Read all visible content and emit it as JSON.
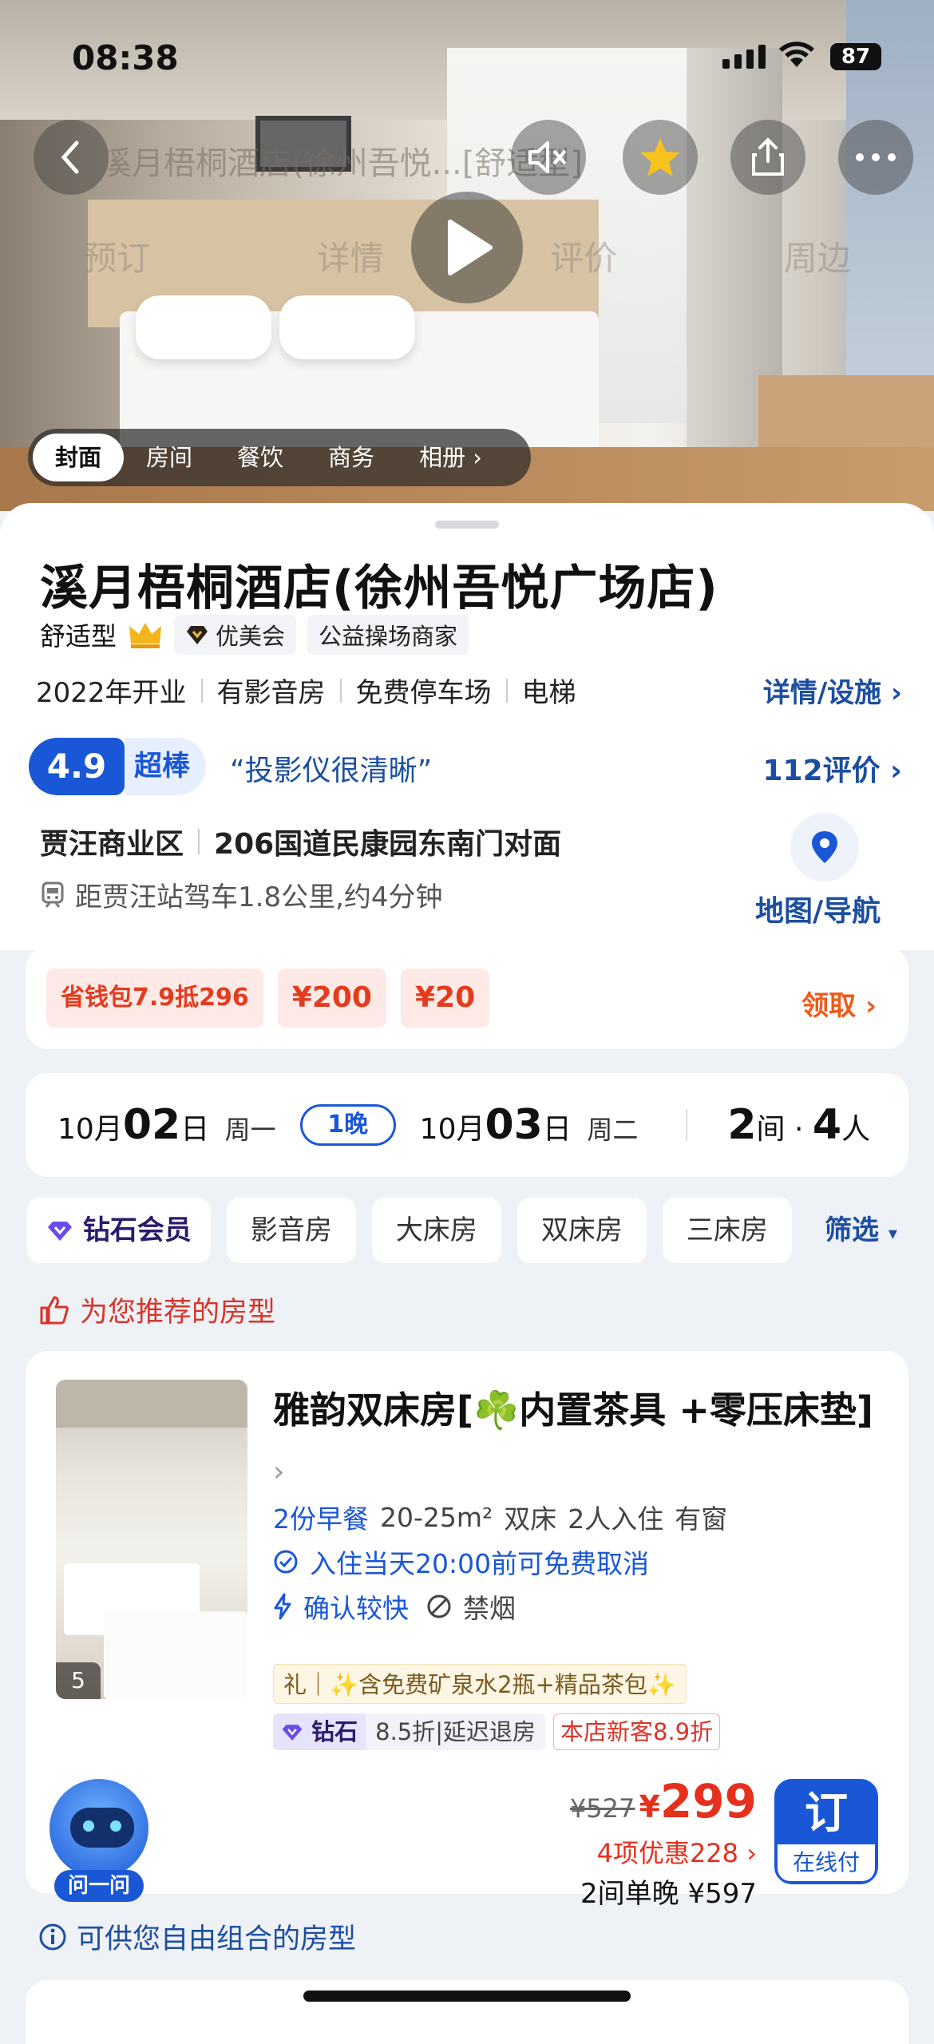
{
  "status_bar": {
    "time": "08:38",
    "battery": "87"
  },
  "nav": {
    "title": "溪月梧桐酒店(徐州吾悦...[舒适型]",
    "tabs": [
      "预订",
      "详情",
      "评价",
      "周边"
    ],
    "collect_label": "收藏",
    "more_label": "更多"
  },
  "media_tabs": [
    "封面",
    "房间",
    "餐饮",
    "商务",
    "相册"
  ],
  "hotel": {
    "name": "溪月梧桐酒店(徐州吾悦广场店)",
    "type": "舒适型",
    "member": "优美会",
    "merchant": "公益操场商家",
    "facilities": [
      "2022年开业",
      "有影音房",
      "免费停车场",
      "电梯"
    ],
    "details_link": "详情/设施",
    "score": "4.9",
    "score_word": "超棒",
    "quote": "“投影仪很清晰”",
    "reviews": "112评价",
    "district": "贾汪商业区",
    "address": "206国道民康园东南门对面",
    "distance": "距贾汪站驾车1.8公里,约4分钟",
    "map_label": "地图/导航"
  },
  "coupons": {
    "items": [
      "省钱包7.9抵296",
      "¥200",
      "¥20"
    ],
    "claim": "领取"
  },
  "dates": {
    "checkin_month": "10月",
    "checkin_day": "02",
    "checkin_unit": "日",
    "checkin_week": "周一",
    "nights": "1晚",
    "checkout_month": "10月",
    "checkout_day": "03",
    "checkout_unit": "日",
    "checkout_week": "周二",
    "rooms": "2",
    "rooms_unit": "间 · ",
    "guests": "4",
    "guests_unit": "人"
  },
  "filters": {
    "diamond": "钻石会员",
    "chips": [
      "影音房",
      "大床房",
      "双床房",
      "三床房"
    ],
    "filter_label": "筛选"
  },
  "recommend_label": "为您推荐的房型",
  "room": {
    "photo_count": "5",
    "title": "雅韵双床房[☘️内置茶具 +零压床垫]",
    "breakfast": "2份早餐",
    "area": "20-25m²",
    "bed": "双床",
    "occupancy": "2人入住",
    "window": "有窗",
    "cancel": "入住当天20:00前可免费取消",
    "confirm": "确认较快",
    "smoke": "禁烟",
    "gift": "礼｜✨含免费矿泉水2瓶+精品茶包✨",
    "diamond_tag": "钻石",
    "diamond_benefit": "8.5折|延迟退房",
    "new_guest": "本店新客8.9折",
    "orig_price": "¥527",
    "price_symbol": "¥",
    "price": "299",
    "discounts": "4项优惠228",
    "total": "2间单晚 ¥597",
    "book": "订",
    "pay": "在线付"
  },
  "assistant_label": "问一问",
  "free_combo_label": "可供您自由组合的房型",
  "colors": {
    "brand_blue": "#1a57d6",
    "link_blue": "#1c4ea0",
    "price_red": "#e5301e",
    "coupon_orange": "#f05a1b"
  }
}
